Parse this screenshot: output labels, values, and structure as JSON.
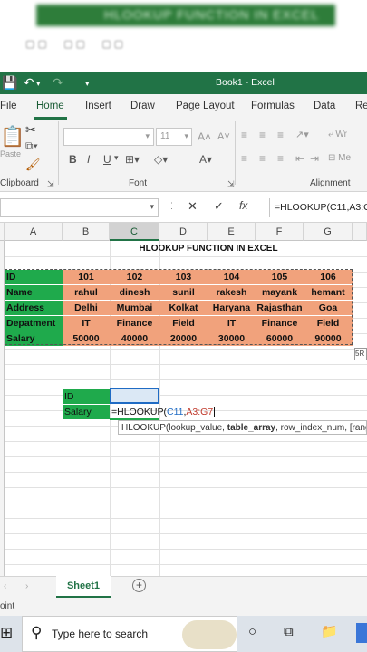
{
  "video_header": {
    "blurred_title": "HLOOKUP FUNCTION IN EXCEL"
  },
  "window": {
    "title": "Book1  -  Excel"
  },
  "ribbon": {
    "tabs": [
      "File",
      "Home",
      "Insert",
      "Draw",
      "Page Layout",
      "Formulas",
      "Data",
      "Re"
    ],
    "active_tab": "Home",
    "clipboard": {
      "paste_label": "Paste",
      "group_label": "Clipboard"
    },
    "font": {
      "font_name": "",
      "font_size": "11",
      "group_label": "Font"
    },
    "alignment": {
      "group_label": "Alignment",
      "wrap_label": "Wr",
      "merge_label": "Me"
    }
  },
  "formula_bar": {
    "name_box": "",
    "formula": "=HLOOKUP(C11,A3:G"
  },
  "grid": {
    "columns": [
      "A",
      "B",
      "C",
      "D",
      "E",
      "F",
      "G"
    ],
    "selected_column": "C",
    "title": "HLOOKUP FUNCTION IN EXCEL",
    "row_labels": [
      "ID",
      "Name",
      "Address",
      "Depatment",
      "Salary"
    ],
    "rows": [
      [
        "101",
        "102",
        "103",
        "104",
        "105",
        "106"
      ],
      [
        "rahul",
        "dinesh",
        "sunil",
        "rakesh",
        "mayank",
        "hemant"
      ],
      [
        "Delhi",
        "Mumbai",
        "Kolkat",
        "Haryana",
        "Rajasthan",
        "Goa"
      ],
      [
        "IT",
        "Finance",
        "Field",
        "IT",
        "Finance",
        "Field"
      ],
      [
        "50000",
        "40000",
        "20000",
        "30000",
        "60000",
        "90000"
      ]
    ],
    "lookup_labels": [
      "ID",
      "Salary"
    ],
    "editing_formula_prefix": "=HLOOKUP(",
    "editing_formula_ref1": "C11",
    "editing_formula_sep": ",",
    "editing_formula_ref2": "A3:G7",
    "tooltip_prefix": "HLOOKUP(lookup_value, ",
    "tooltip_bold": "table_array",
    "tooltip_suffix": ", row_index_num, [range",
    "float_button": "5R"
  },
  "sheets": {
    "active": "Sheet1",
    "add_label": "+"
  },
  "status": {
    "mode": "oint"
  },
  "taskbar": {
    "search_placeholder": "Type here to search"
  },
  "colors": {
    "excel_green": "#217346",
    "header_green": "#1faa4c",
    "salmon": "#f1a27c",
    "ref_blue": "#1f6bc4",
    "ref_red": "#c0392b"
  }
}
